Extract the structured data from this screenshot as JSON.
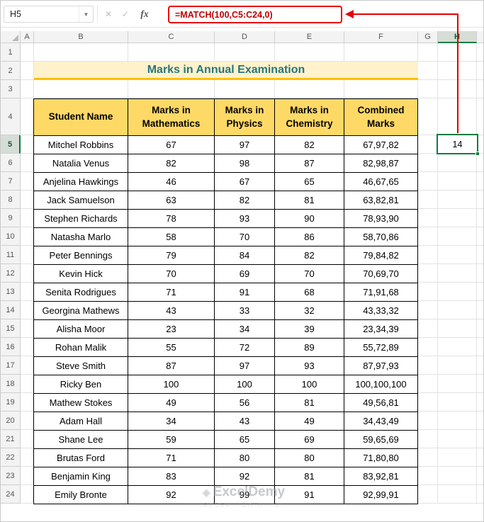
{
  "formula_bar": {
    "name_box": "H5",
    "cancel_label": "✕",
    "enter_label": "✓",
    "fx_label": "fx",
    "formula": "=MATCH(100,C5:C24,0)"
  },
  "grid": {
    "column_headers": [
      "A",
      "B",
      "C",
      "D",
      "E",
      "F",
      "G",
      "H"
    ],
    "row_count": 24,
    "selected": {
      "column": "H",
      "row": 5,
      "cell": "H5",
      "value": "14"
    }
  },
  "sheet": {
    "title": "Marks in Annual Examination",
    "table": {
      "headers": [
        "Student Name",
        "Marks in\nMathematics",
        "Marks in\nPhysics",
        "Marks in\nChemistry",
        "Combined\nMarks"
      ],
      "rows": [
        [
          "Mitchel Robbins",
          "67",
          "97",
          "82",
          "67,97,82"
        ],
        [
          "Natalia Venus",
          "82",
          "98",
          "87",
          "82,98,87"
        ],
        [
          "Anjelina Hawkings",
          "46",
          "67",
          "65",
          "46,67,65"
        ],
        [
          "Jack Samuelson",
          "63",
          "82",
          "81",
          "63,82,81"
        ],
        [
          "Stephen Richards",
          "78",
          "93",
          "90",
          "78,93,90"
        ],
        [
          "Natasha Marlo",
          "58",
          "70",
          "86",
          "58,70,86"
        ],
        [
          "Peter Bennings",
          "79",
          "84",
          "82",
          "79,84,82"
        ],
        [
          "Kevin Hick",
          "70",
          "69",
          "70",
          "70,69,70"
        ],
        [
          "Senita Rodrigues",
          "71",
          "91",
          "68",
          "71,91,68"
        ],
        [
          "Georgina Mathews",
          "43",
          "33",
          "32",
          "43,33,32"
        ],
        [
          "Alisha Moor",
          "23",
          "34",
          "39",
          "23,34,39"
        ],
        [
          "Rohan Malik",
          "55",
          "72",
          "89",
          "55,72,89"
        ],
        [
          "Steve Smith",
          "87",
          "97",
          "93",
          "87,97,93"
        ],
        [
          "Ricky Ben",
          "100",
          "100",
          "100",
          "100,100,100"
        ],
        [
          "Mathew Stokes",
          "49",
          "56",
          "81",
          "49,56,81"
        ],
        [
          "Adam Hall",
          "34",
          "43",
          "49",
          "34,43,49"
        ],
        [
          "Shane Lee",
          "59",
          "65",
          "69",
          "59,65,69"
        ],
        [
          "Brutas Ford",
          "71",
          "80",
          "80",
          "71,80,80"
        ],
        [
          "Benjamin King",
          "83",
          "92",
          "81",
          "83,92,81"
        ],
        [
          "Emily Bronte",
          "92",
          "99",
          "91",
          "92,99,91"
        ]
      ]
    }
  },
  "watermark": {
    "brand": "ExcelDemy",
    "diamond_icon": "◈",
    "tagline": "EXCEL · DATA · BI"
  },
  "colors": {
    "annotation_red": "#e60000",
    "formula_text": "#c00000",
    "selection_green": "#107c41",
    "title_text": "#26777b",
    "title_bg": "#fff2cc",
    "title_underline": "#ffc000",
    "header_bg": "#ffd966"
  }
}
